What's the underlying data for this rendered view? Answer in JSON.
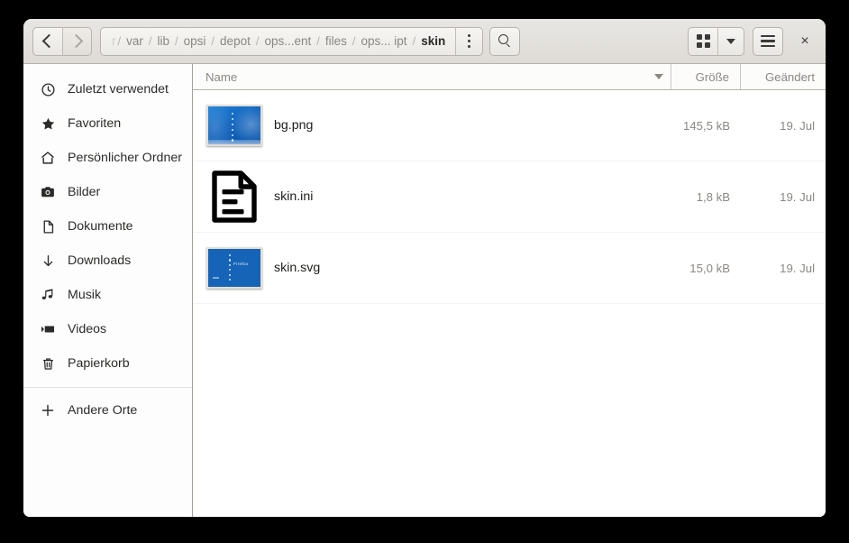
{
  "window": {
    "close_label": "×"
  },
  "headerbar": {
    "nav": {
      "back_label": "",
      "forward_label": ""
    },
    "breadcrumb": {
      "truncated_prefix": "r",
      "separator": "/",
      "items": [
        {
          "label": "var",
          "current": false
        },
        {
          "label": "lib",
          "current": false
        },
        {
          "label": "opsi",
          "current": false
        },
        {
          "label": "depot",
          "current": false
        },
        {
          "label": "ops...ent",
          "current": false
        },
        {
          "label": "files",
          "current": false
        },
        {
          "label": "ops... ipt",
          "current": false
        },
        {
          "label": "skin",
          "current": true
        }
      ]
    },
    "path_menu_icon": "three-dots-vertical-icon",
    "search_icon": "search-icon",
    "view_grid_icon": "grid-view-icon",
    "view_dropdown_icon": "chevron-down-icon",
    "hamburger_icon": "hamburger-menu-icon",
    "close_icon": "close-icon"
  },
  "sidebar": {
    "items": [
      {
        "label": "Zuletzt verwendet",
        "icon": "clock-icon"
      },
      {
        "label": "Favoriten",
        "icon": "star-icon"
      },
      {
        "label": "Persönlicher Ordner",
        "icon": "home-icon"
      },
      {
        "label": "Bilder",
        "icon": "camera-icon"
      },
      {
        "label": "Dokumente",
        "icon": "document-icon"
      },
      {
        "label": "Downloads",
        "icon": "download-arrow-icon"
      },
      {
        "label": "Musik",
        "icon": "music-note-icon"
      },
      {
        "label": "Videos",
        "icon": "video-icon"
      },
      {
        "label": "Papierkorb",
        "icon": "trash-icon"
      }
    ],
    "other_locations": {
      "label": "Andere Orte",
      "icon": "plus-icon"
    }
  },
  "filelist": {
    "columns": {
      "name": "Name",
      "size": "Größe",
      "modified": "Geändert"
    },
    "sort_indicator": "sort-descending-icon",
    "rows": [
      {
        "name": "bg.png",
        "size": "145,5 kB",
        "modified": "19. Jul",
        "thumbnail": "wallpaper-thumbnail"
      },
      {
        "name": "skin.ini",
        "size": "1,8 kB",
        "modified": "19. Jul",
        "thumbnail": "text-document-icon"
      },
      {
        "name": "skin.svg",
        "size": "15,0 kB",
        "modified": "19. Jul",
        "thumbnail": "svg-image-thumbnail",
        "thumbnail_text": "Firefox"
      }
    ]
  },
  "colors": {
    "headerbar_top": "#e8e6e3",
    "headerbar_bottom": "#dedbd6",
    "border": "#b6b0a9",
    "text": "#2b2b29",
    "muted_text": "#8b8882",
    "thumb_blue": "#1564b8"
  }
}
